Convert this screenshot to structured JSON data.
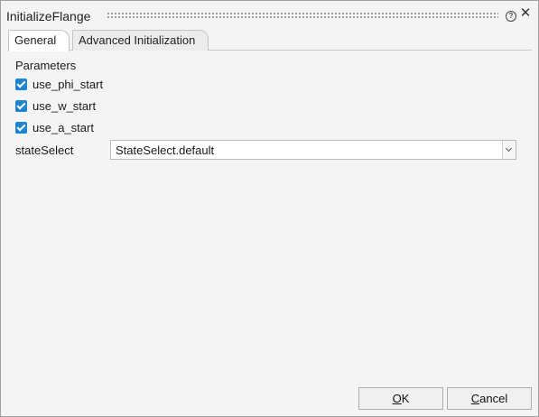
{
  "window": {
    "title": "InitializeFlange",
    "help_icon": "question-circle-icon",
    "close_icon": "close-icon"
  },
  "tabs": [
    {
      "label": "General",
      "active": true
    },
    {
      "label": "Advanced Initialization",
      "active": false
    }
  ],
  "general": {
    "section_title": "Parameters",
    "checkboxes": [
      {
        "label": "use_phi_start",
        "checked": true
      },
      {
        "label": "use_w_start",
        "checked": true
      },
      {
        "label": "use_a_start",
        "checked": true
      }
    ],
    "state_select": {
      "label": "stateSelect",
      "value": "StateSelect.default"
    }
  },
  "buttons": {
    "ok_access_key": "O",
    "ok_rest": "K",
    "cancel_access_key": "C",
    "cancel_rest": "ancel"
  },
  "colors": {
    "accent": "#1d85d0",
    "background": "#f4f4f4"
  }
}
